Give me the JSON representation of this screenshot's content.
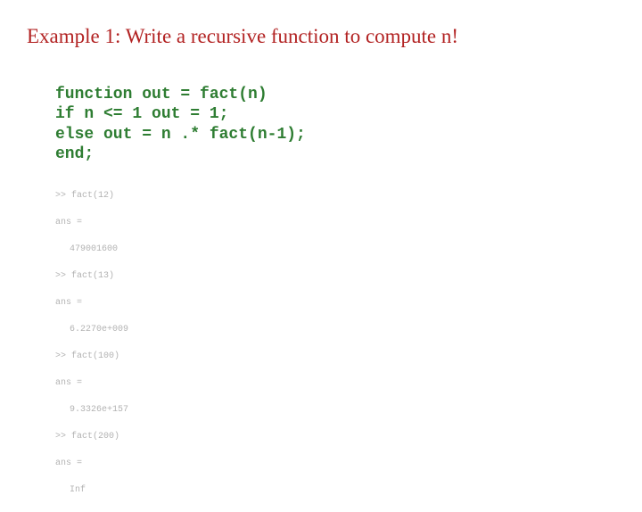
{
  "title": "Example 1: Write a recursive function to compute n!",
  "code": {
    "line1": "function out = fact(n)",
    "line2": "if n <= 1 out = 1;",
    "line3": "else out = n .* fact(n-1);",
    "line4": "end;"
  },
  "console": {
    "e1_prompt": ">> fact(12)",
    "e1_ans": "ans =",
    "e1_val": "479001600",
    "e2_prompt": ">> fact(13)",
    "e2_ans": "ans =",
    "e2_val": "6.2270e+009",
    "e3_prompt": ">> fact(100)",
    "e3_ans": "ans =",
    "e3_val": "9.3326e+157",
    "e4_prompt": ">> fact(200)",
    "e4_ans": "ans =",
    "e4_val": "Inf"
  }
}
